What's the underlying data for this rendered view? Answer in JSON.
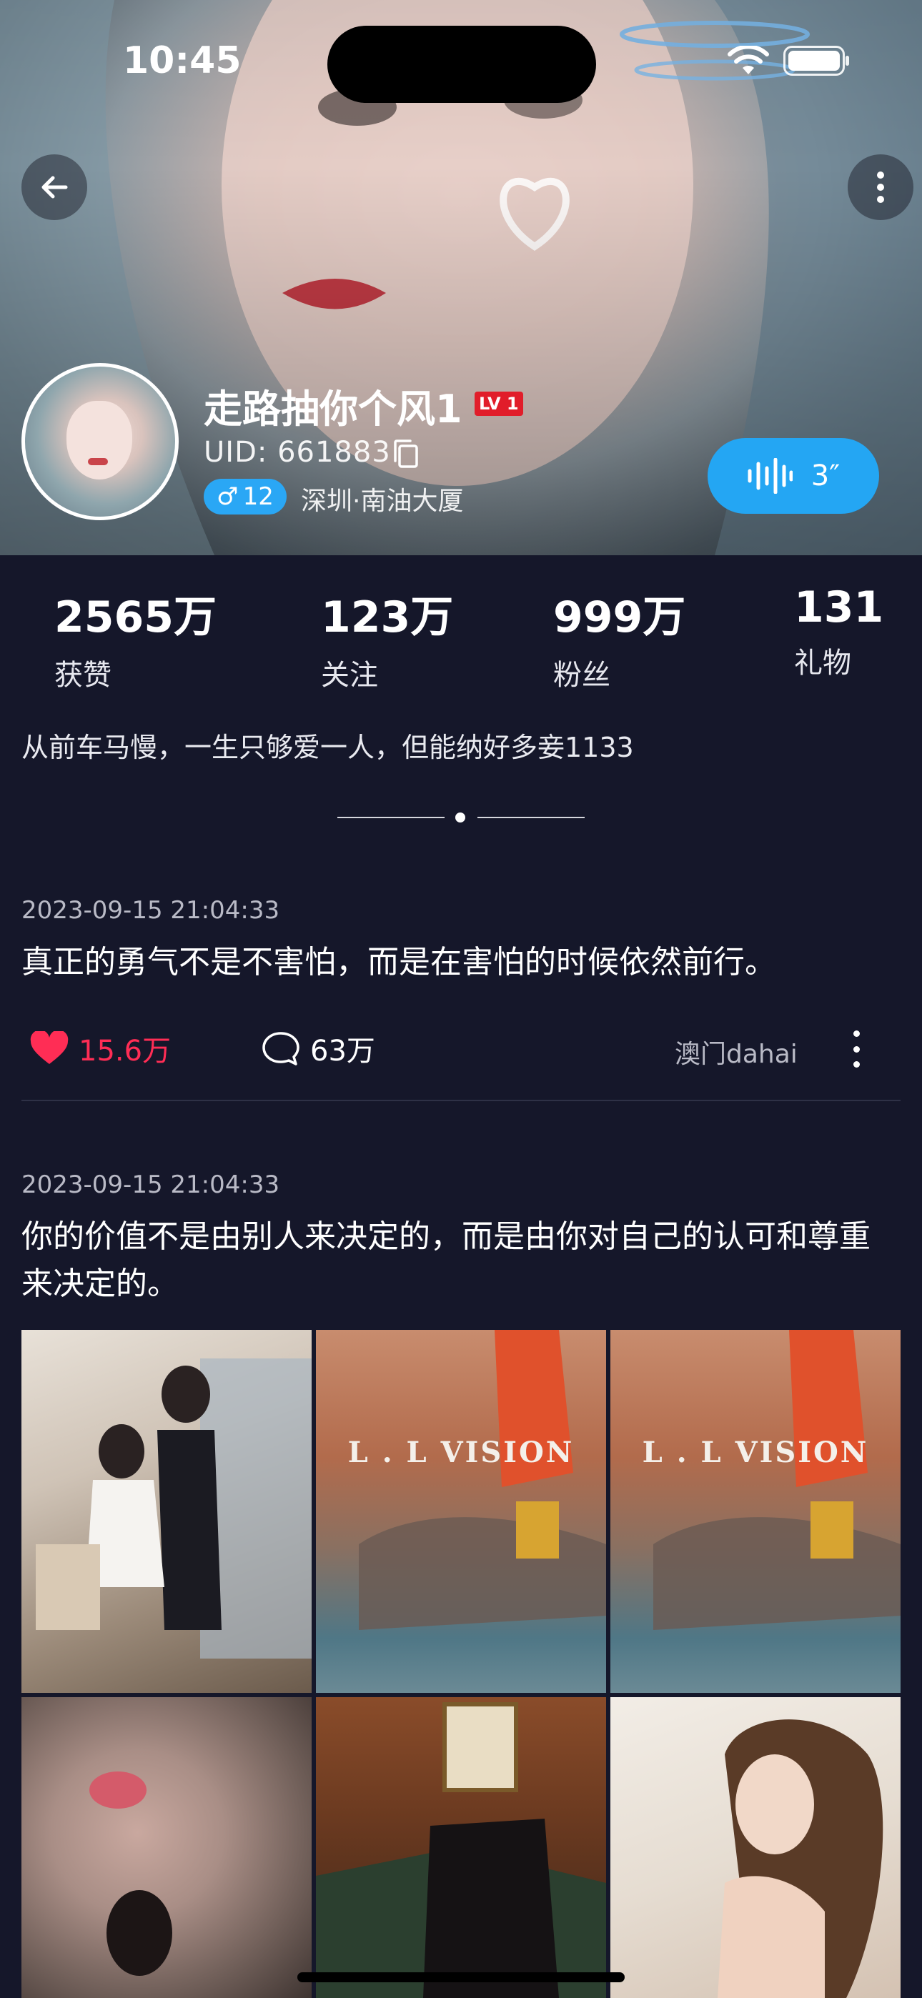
{
  "status_bar": {
    "time": "10:45"
  },
  "profile": {
    "name": "走路抽你个风1",
    "level": "LV 1",
    "uid": "UID: 661883",
    "gender_badge": {
      "symbol": "♂",
      "age": "12"
    },
    "location": "深圳·南油大厦",
    "voice_duration": "3″"
  },
  "stats": [
    {
      "value": "2565万",
      "label": "获赞"
    },
    {
      "value": "123万",
      "label": "关注"
    },
    {
      "value": "999万",
      "label": "粉丝"
    },
    {
      "value": "131",
      "label": "礼物"
    }
  ],
  "bio": "从前车马慢，一生只够爱一人，但能纳好多妾1133",
  "posts": [
    {
      "date": "2023-09-15 21:04:33",
      "text": "真正的勇气不是不害怕，而是在害怕的时候依然前行。",
      "likes": "15.6万",
      "comments": "63万",
      "author": "澳门dahai"
    },
    {
      "date": "2023-09-15 21:04:33",
      "text": "你的价值不是由别人来决定的，而是由你对自己的认可和尊重来决定的。",
      "images": [
        {
          "watermark": ""
        },
        {
          "watermark": "L . L VISION"
        },
        {
          "watermark": "L . L VISION"
        },
        {
          "watermark": ""
        },
        {
          "watermark": ""
        },
        {
          "watermark": ""
        }
      ]
    }
  ],
  "colors": {
    "background": "#15172a",
    "accent_blue": "#24a6f3",
    "like_red": "#ff2d55",
    "level_red": "#e11d2a"
  }
}
